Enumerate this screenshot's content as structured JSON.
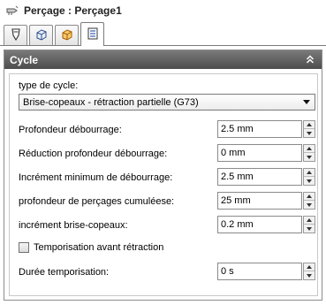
{
  "window": {
    "title": "Perçage : Perçage1",
    "icon": "drill-icon"
  },
  "tabs": [
    {
      "icon": "tool-icon",
      "active": false
    },
    {
      "icon": "geometry-icon",
      "active": false
    },
    {
      "icon": "heights-icon",
      "active": false
    },
    {
      "icon": "passes-icon",
      "active": true
    }
  ],
  "section": {
    "title": "Cycle",
    "collapse_icon": "collapse-chevrons-icon"
  },
  "cycle": {
    "type_label": "type de cycle:",
    "type_value": "Brise-copeaux - rétraction partielle (G73)"
  },
  "fields": [
    {
      "label": "Profondeur débourrage:",
      "value": "2.5 mm"
    },
    {
      "label": "Réduction profondeur débourrage:",
      "value": "0 mm"
    },
    {
      "label": "Incrément minimum de débourrage:",
      "value": "2.5 mm"
    },
    {
      "label": "profondeur de perçages cumuléese:",
      "value": "25 mm"
    },
    {
      "label": "incrément brise-copeaux:",
      "value": "0.2 mm"
    }
  ],
  "temporisation": {
    "label": "Temporisation avant rétraction",
    "checked": false
  },
  "duree": {
    "label": "Durée temporisation:",
    "value": "0 s"
  }
}
